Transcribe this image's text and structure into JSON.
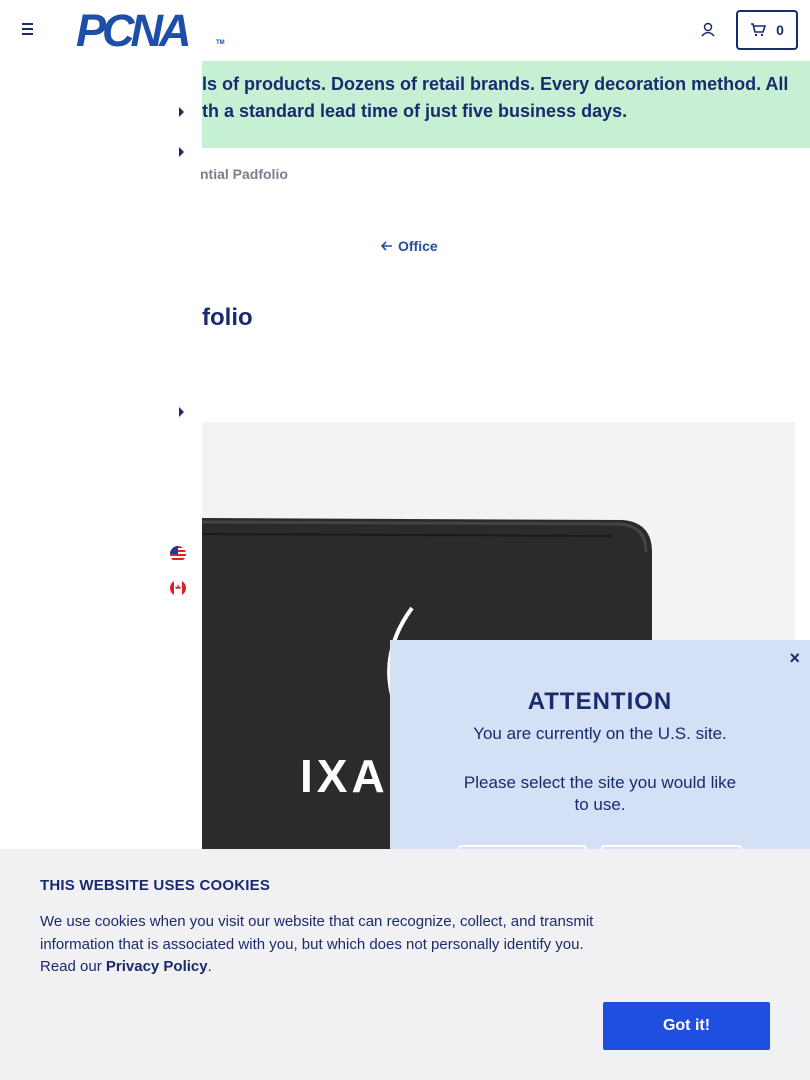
{
  "header": {
    "logo_text": "PCNA",
    "logo_tm": "TM",
    "cart_count": "0"
  },
  "banner": {
    "line1": "ls of products. Dozens of retail brands. Every decoration method. All",
    "line2": "th a standard lead time of just five business days."
  },
  "breadcrumb": {
    "current": "ntial Padfolio"
  },
  "back_link": {
    "label": "Office"
  },
  "product": {
    "title_fragment": "folio",
    "image_logo_text": "IXA"
  },
  "modal": {
    "close_glyph": "×",
    "heading": "ATTENTION",
    "line1": "You are currently on the U.S. site.",
    "line2": "Please select the site you would like to use."
  },
  "cookie": {
    "title": "THIS WEBSITE USES COOKIES",
    "body": "We use cookies when you visit our website that can recognize, collect, and transmit information that is associated with you, but which does not personally identify you. Read our ",
    "policy_link": "Privacy Policy",
    "body_end": ".",
    "button": "Got it!"
  },
  "colors": {
    "navy": "#1a2b6d",
    "brand_blue": "#1e4fa8",
    "banner_green": "#c6f0d4",
    "modal_blue": "#d3e0f5",
    "button_blue": "#1f4fe0"
  }
}
